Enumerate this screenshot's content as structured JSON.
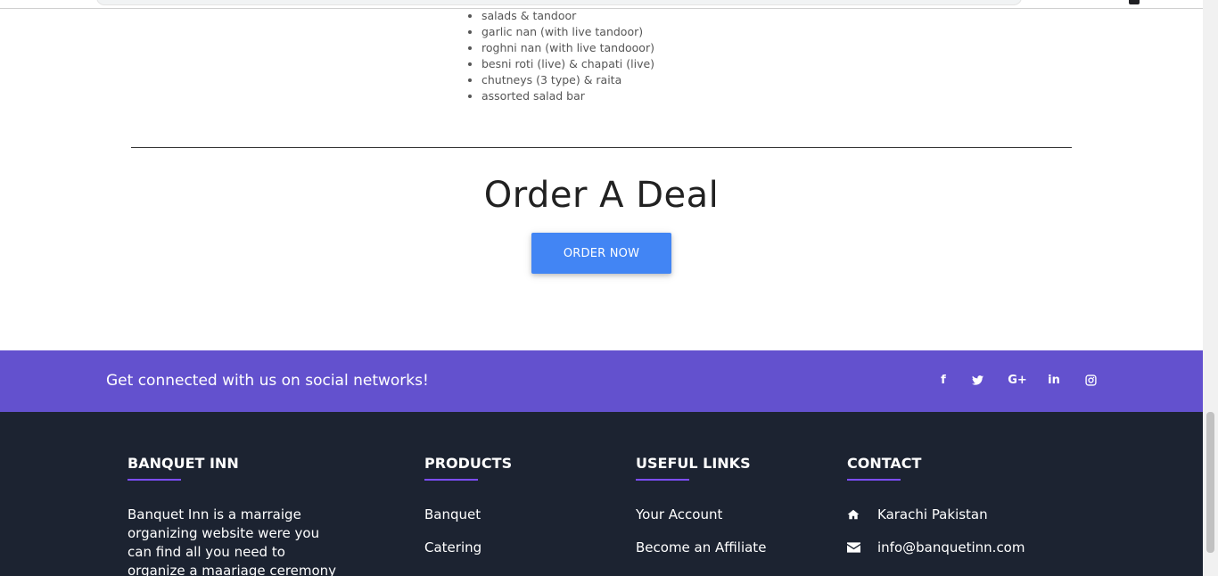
{
  "menu": {
    "items": [
      "salads & tandoor",
      "garlic nan (with live tandoor)",
      "roghni nan (with live tandooor)",
      "besni roti (live) & chapati (live)",
      "chutneys (3 type) & raita",
      "assorted salad bar"
    ]
  },
  "order": {
    "title": "Order A Deal",
    "button_label": "ORDER NOW"
  },
  "social": {
    "text": "Get connected with us on social networks!",
    "icons": [
      {
        "name": "facebook-icon",
        "glyph": "f"
      },
      {
        "name": "twitter-icon",
        "glyph": "🐦"
      },
      {
        "name": "google-plus-icon",
        "glyph": "G+"
      },
      {
        "name": "linkedin-icon",
        "glyph": "in"
      },
      {
        "name": "instagram-icon",
        "glyph": "◎"
      }
    ],
    "band_color": "#6351ce"
  },
  "footer": {
    "background": "#1c2331",
    "brand": {
      "title": "BANQUET INN",
      "about": "Banquet Inn is a marraige organizing website were you can find all you need to organize a maariage ceremony right before"
    },
    "products": {
      "title": "PRODUCTS",
      "links": [
        "Banquet",
        "Catering"
      ]
    },
    "useful_links": {
      "title": "USEFUL LINKS",
      "links": [
        "Your Account",
        "Become an Affiliate"
      ]
    },
    "contact": {
      "title": "CONTACT",
      "location": "Karachi Pakistan",
      "email": "info@banquetinn.com"
    }
  },
  "colors": {
    "accent_button": "#4285f4",
    "heading_underline": "#7c4dff"
  }
}
